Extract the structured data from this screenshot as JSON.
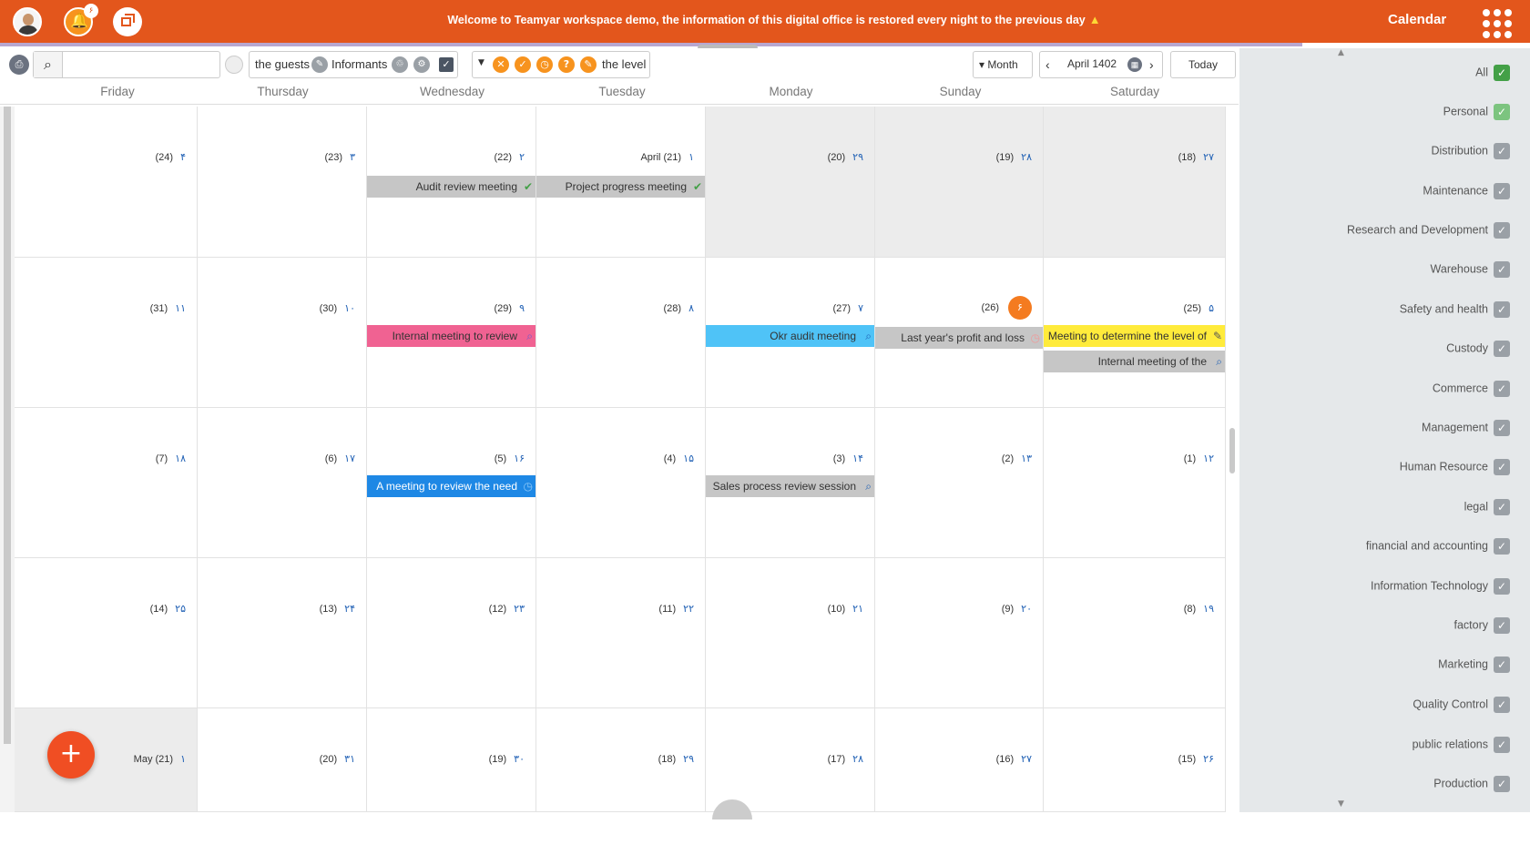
{
  "topbar": {
    "welcome": "Welcome to Teamyar workspace demo, the information of this digital office is restored every night to the previous day",
    "title": "Calendar",
    "notification_count": "۶"
  },
  "toolbar": {
    "search_placeholder": "",
    "filter_guests": "the guests",
    "filter_informants": "Informants",
    "status_level": "the level",
    "view_mode": "Month",
    "period_label": "April 1402",
    "today_label": "Today"
  },
  "days": [
    "Friday",
    "Thursday",
    "Wednesday",
    "Tuesday",
    "Monday",
    "Sunday",
    "Saturday"
  ],
  "weeks": [
    [
      {
        "greg": "(24)",
        "fa": "۴"
      },
      {
        "greg": "(23)",
        "fa": "۳"
      },
      {
        "greg": "(22)",
        "fa": "۲"
      },
      {
        "greg": "April (21)",
        "fa": "۱"
      },
      {
        "greg": "(20)",
        "fa": "۲۹"
      },
      {
        "greg": "(19)",
        "fa": "۲۸"
      },
      {
        "greg": "(18)",
        "fa": "۲۷"
      }
    ],
    [
      {
        "greg": "(31)",
        "fa": "۱۱"
      },
      {
        "greg": "(30)",
        "fa": "۱۰"
      },
      {
        "greg": "(29)",
        "fa": "۹"
      },
      {
        "greg": "(28)",
        "fa": "۸"
      },
      {
        "greg": "(27)",
        "fa": "۷"
      },
      {
        "greg": "(26)",
        "fa": "۶"
      },
      {
        "greg": "(25)",
        "fa": "۵"
      }
    ],
    [
      {
        "greg": "(7)",
        "fa": "۱۸"
      },
      {
        "greg": "(6)",
        "fa": "۱۷"
      },
      {
        "greg": "(5)",
        "fa": "۱۶"
      },
      {
        "greg": "(4)",
        "fa": "۱۵"
      },
      {
        "greg": "(3)",
        "fa": "۱۴"
      },
      {
        "greg": "(2)",
        "fa": "۱۳"
      },
      {
        "greg": "(1)",
        "fa": "۱۲"
      }
    ],
    [
      {
        "greg": "(14)",
        "fa": "۲۵"
      },
      {
        "greg": "(13)",
        "fa": "۲۴"
      },
      {
        "greg": "(12)",
        "fa": "۲۳"
      },
      {
        "greg": "(11)",
        "fa": "۲۲"
      },
      {
        "greg": "(10)",
        "fa": "۲۱"
      },
      {
        "greg": "(9)",
        "fa": "۲۰"
      },
      {
        "greg": "(8)",
        "fa": "۱۹"
      }
    ],
    [
      {
        "greg": "May (21)",
        "fa": "۱"
      },
      {
        "greg": "(20)",
        "fa": "۳۱"
      },
      {
        "greg": "(19)",
        "fa": "۳۰"
      },
      {
        "greg": "(18)",
        "fa": "۲۹"
      },
      {
        "greg": "(17)",
        "fa": "۲۸"
      },
      {
        "greg": "(16)",
        "fa": "۲۷"
      },
      {
        "greg": "(15)",
        "fa": "۲۶"
      }
    ]
  ],
  "events": [
    {
      "title": "Audit review meeting",
      "color": "#c6c6c6",
      "icon": "check-icon"
    },
    {
      "title": "Project progress meeting",
      "color": "#c6c6c6",
      "icon": "check-icon"
    },
    {
      "title": "Internal meeting to review",
      "color": "#f06292",
      "icon": "search-icon"
    },
    {
      "title": "Okr audit meeting",
      "color": "#4fc3f7",
      "icon": "search-icon"
    },
    {
      "title": "Last year's profit and loss",
      "color": "#c6c6c6",
      "icon": "clock-icon"
    },
    {
      "title": "Meeting to determine the level of",
      "color": "#ffeb3b",
      "icon": "pencil-icon"
    },
    {
      "title": "Internal meeting of the",
      "color": "#c6c6c6",
      "icon": "search-icon"
    },
    {
      "title": "A meeting to review the need",
      "color": "#1e88e5",
      "icon": "clock-icon"
    },
    {
      "title": "Sales process review session",
      "color": "#c6c6c6",
      "icon": "search-icon"
    }
  ],
  "sidebar": {
    "items": [
      {
        "label": "All"
      },
      {
        "label": "Personal"
      },
      {
        "label": "Distribution"
      },
      {
        "label": "Maintenance"
      },
      {
        "label": "Research and Development"
      },
      {
        "label": "Warehouse"
      },
      {
        "label": "Safety and health"
      },
      {
        "label": "Custody"
      },
      {
        "label": "Commerce"
      },
      {
        "label": "Management"
      },
      {
        "label": "Human Resource"
      },
      {
        "label": "legal"
      },
      {
        "label": "financial and accounting"
      },
      {
        "label": "Information Technology"
      },
      {
        "label": "factory"
      },
      {
        "label": "Marketing"
      },
      {
        "label": "Quality Control"
      },
      {
        "label": "public relations"
      },
      {
        "label": "Production"
      }
    ]
  },
  "colors": {
    "accent": "#e3561c",
    "today": "#f47b20",
    "fab": "#f04e23"
  }
}
